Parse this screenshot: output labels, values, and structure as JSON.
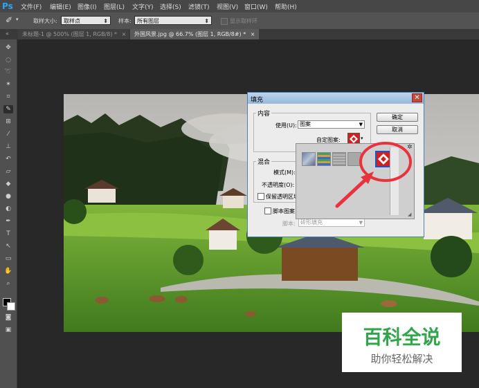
{
  "app": {
    "logo": "Ps"
  },
  "menu": [
    "文件(F)",
    "编辑(E)",
    "图像(I)",
    "图层(L)",
    "文字(Y)",
    "选择(S)",
    "滤镜(T)",
    "视图(V)",
    "窗口(W)",
    "帮助(H)"
  ],
  "options": {
    "sample_size_label": "取样大小:",
    "sample_size_value": "取样点",
    "sample_label": "样本:",
    "sample_value": "所有图层",
    "show_ring_label": "显示取样环"
  },
  "tabs": [
    {
      "label": "未标题-1 @ 500% (图层 1, RGB/8) *",
      "close": "×"
    },
    {
      "label": "外国风景.jpg @ 66.7% (图层 1, RGB/8#) *",
      "close": "×"
    }
  ],
  "dialog": {
    "title": "填充",
    "close": "✕",
    "content_group": "内容",
    "use_label": "使用(U):",
    "use_value": "图案",
    "custom_pattern_label": "自定图案:",
    "blend_group": "混合",
    "mode_label": "模式(M):",
    "opacity_label": "不透明度(O):",
    "preserve_label": "保留透明区域",
    "script_label": "脚本图案",
    "script_field_label": "脚本:",
    "script_value": "砖形填充",
    "ok_button": "确定",
    "cancel_button": "取消"
  },
  "colors": {
    "annotation": "#e8323c",
    "dialog_border": "#4a7fb8"
  },
  "watermark": {
    "title": "百科全说",
    "subtitle": "助你轻松解决"
  }
}
